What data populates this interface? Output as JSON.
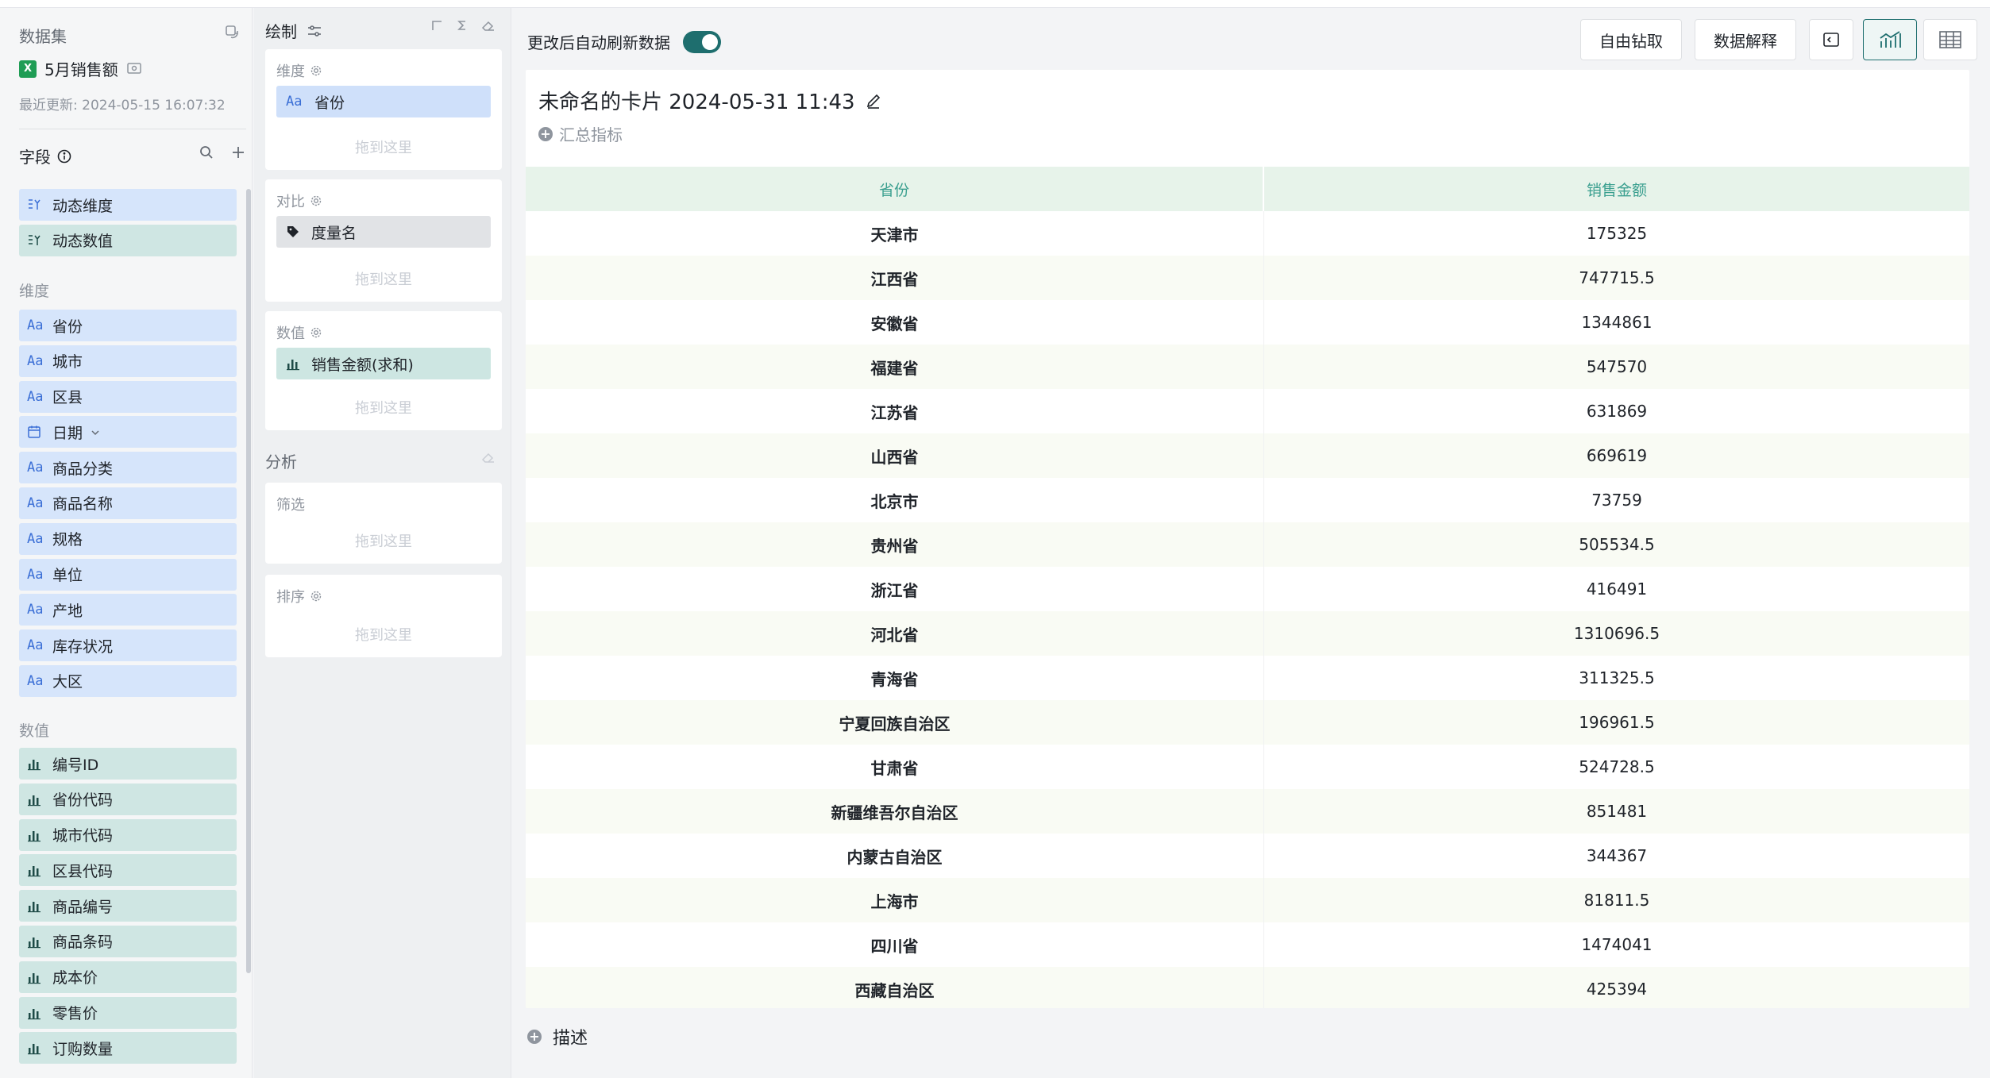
{
  "dataset": {
    "section_label": "数据集",
    "name": "5月销售额",
    "updated": "最近更新: 2024-05-15 16:07:32"
  },
  "fields": {
    "heading": "字段",
    "dynamic": [
      {
        "label": "动态维度"
      },
      {
        "label": "动态数值"
      }
    ],
    "dimension_label": "维度",
    "dimensions": [
      {
        "label": "省份",
        "icon": "text-type-icon"
      },
      {
        "label": "城市",
        "icon": "text-type-icon"
      },
      {
        "label": "区县",
        "icon": "text-type-icon"
      },
      {
        "label": "日期",
        "icon": "calendar-icon"
      },
      {
        "label": "商品分类",
        "icon": "text-type-icon"
      },
      {
        "label": "商品名称",
        "icon": "text-type-icon"
      },
      {
        "label": "规格",
        "icon": "text-type-icon"
      },
      {
        "label": "单位",
        "icon": "text-type-icon"
      },
      {
        "label": "产地",
        "icon": "text-type-icon"
      },
      {
        "label": "库存状况",
        "icon": "text-type-icon"
      },
      {
        "label": "大区",
        "icon": "text-type-icon"
      }
    ],
    "measure_label": "数值",
    "measures": [
      {
        "label": "编号ID"
      },
      {
        "label": "省份代码"
      },
      {
        "label": "城市代码"
      },
      {
        "label": "区县代码"
      },
      {
        "label": "商品编号"
      },
      {
        "label": "商品条码"
      },
      {
        "label": "成本价"
      },
      {
        "label": "零售价"
      },
      {
        "label": "订购数量"
      }
    ],
    "text_glyph": "Aa"
  },
  "build": {
    "heading": "绘制",
    "drop_hint": "拖到这里",
    "dimension": {
      "title": "维度",
      "pill": "省份"
    },
    "compare": {
      "title": "对比",
      "pill": "度量名"
    },
    "value": {
      "title": "数值",
      "pill": "销售金额(求和)"
    },
    "analysis": "分析",
    "filter": "筛选",
    "sort": "排序"
  },
  "toolbar": {
    "auto_refresh": "更改后自动刷新数据",
    "auto_refresh_on": true,
    "drill": "自由钻取",
    "explain": "数据解释"
  },
  "card": {
    "title": "未命名的卡片 2024-05-31 11:43",
    "summary": "汇总指标",
    "describe": "描述"
  },
  "table": {
    "columns": [
      "省份",
      "销售金额"
    ],
    "rows": [
      [
        "天津市",
        "175325"
      ],
      [
        "江西省",
        "747715.5"
      ],
      [
        "安徽省",
        "1344861"
      ],
      [
        "福建省",
        "547570"
      ],
      [
        "江苏省",
        "631869"
      ],
      [
        "山西省",
        "669619"
      ],
      [
        "北京市",
        "73759"
      ],
      [
        "贵州省",
        "505534.5"
      ],
      [
        "浙江省",
        "416491"
      ],
      [
        "河北省",
        "1310696.5"
      ],
      [
        "青海省",
        "311325.5"
      ],
      [
        "宁夏回族自治区",
        "196961.5"
      ],
      [
        "甘肃省",
        "524728.5"
      ],
      [
        "新疆维吾尔自治区",
        "851481"
      ],
      [
        "内蒙古自治区",
        "344367"
      ],
      [
        "上海市",
        "81811.5"
      ],
      [
        "四川省",
        "1474041"
      ],
      [
        "西藏自治区",
        "425394"
      ]
    ]
  },
  "colors": {
    "accent": "#1e6e6e",
    "dimension_bg": "#d6e5fb",
    "measure_bg": "#cfe6e3",
    "table_header_bg": "#e7f3ea",
    "table_header_text": "#3a9f8f"
  }
}
